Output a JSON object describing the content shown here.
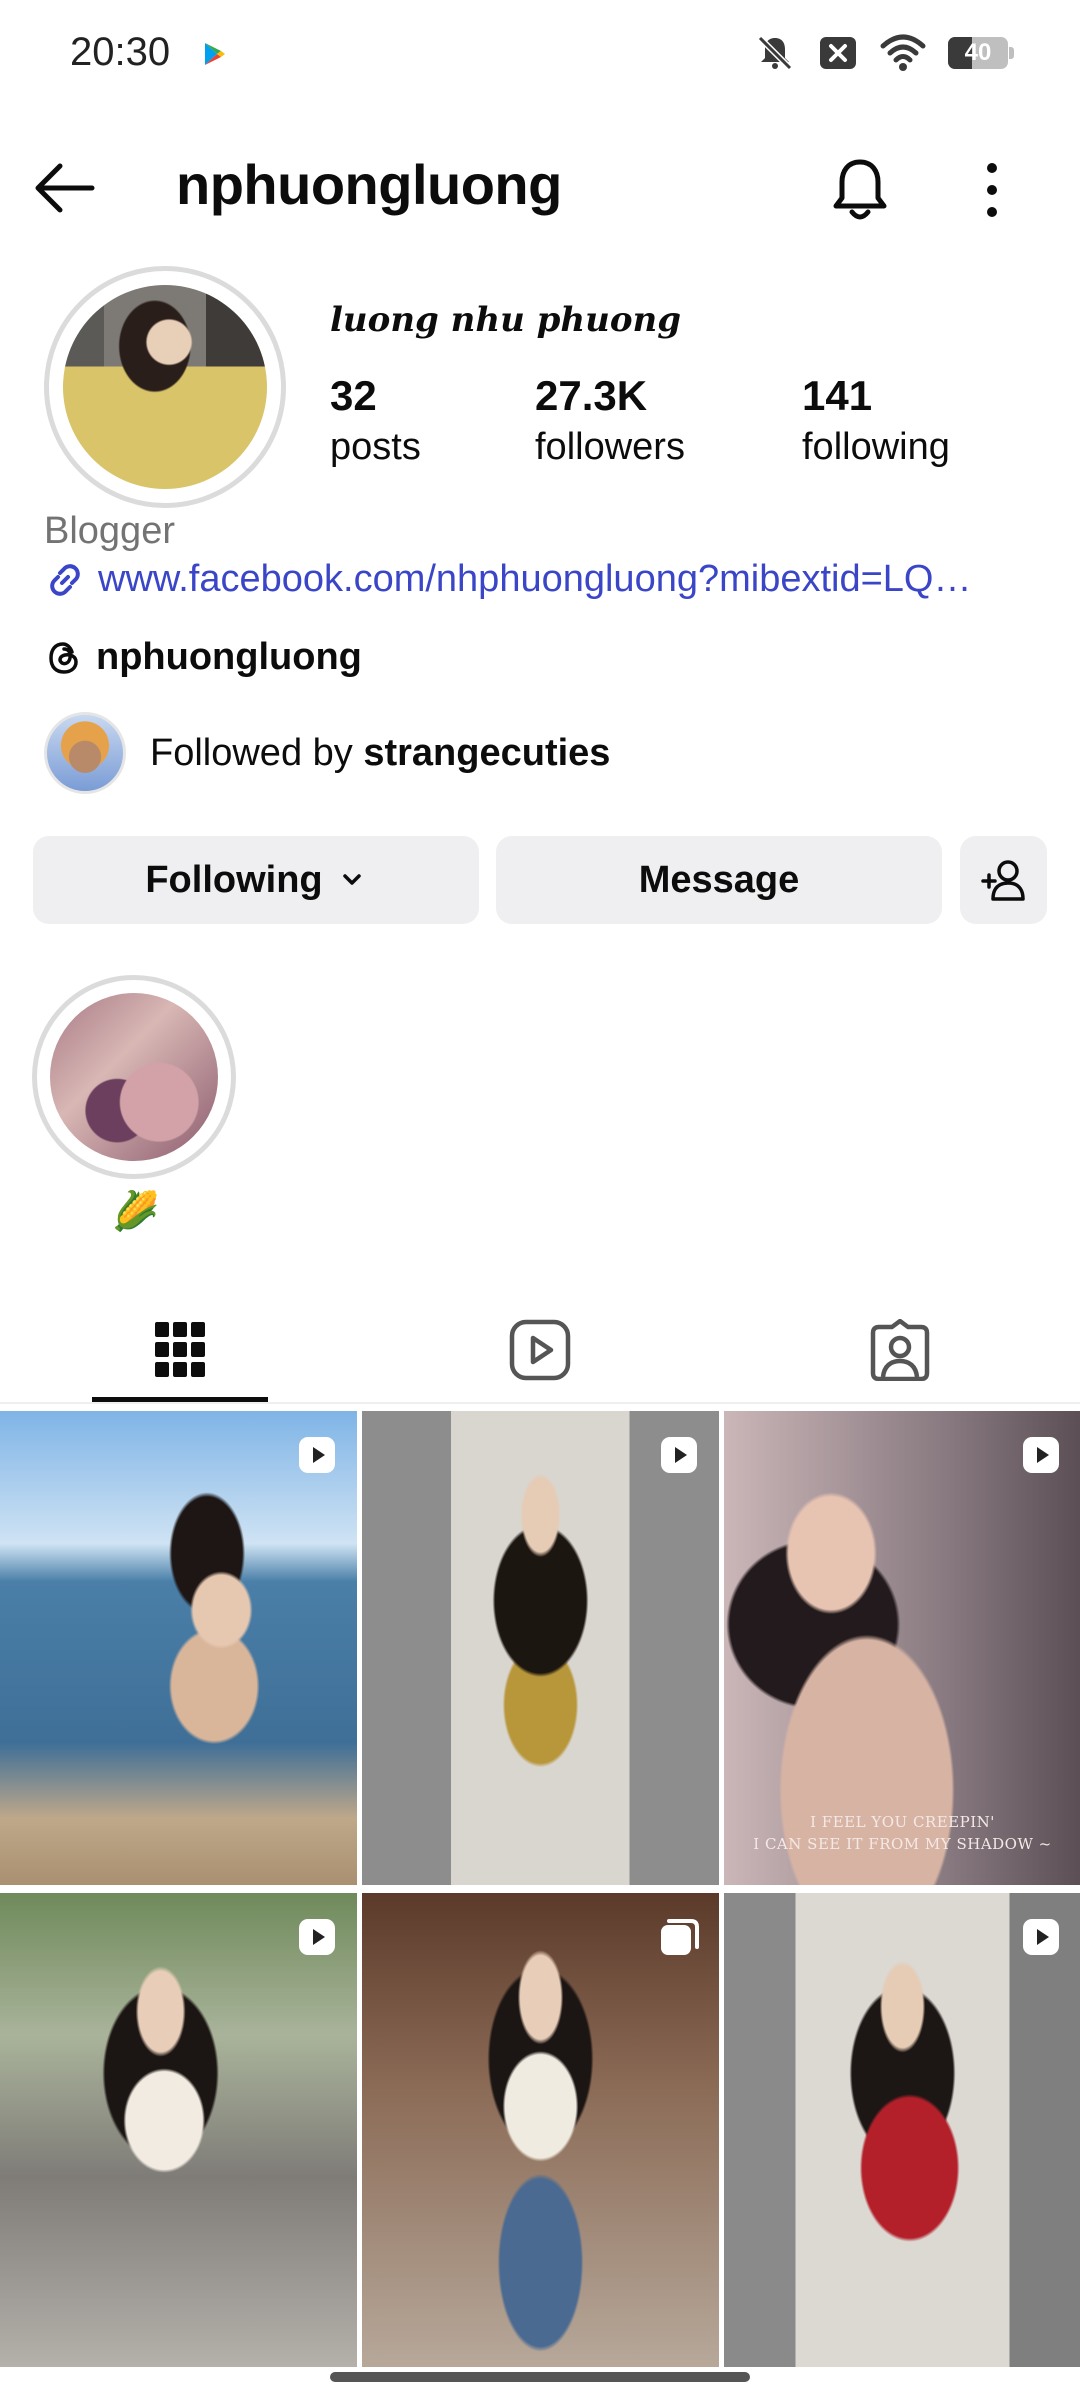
{
  "status_bar": {
    "time": "20:30",
    "battery": "40",
    "battery_level": 0.4
  },
  "header": {
    "title": "nphuongluong"
  },
  "profile": {
    "full_name": "luong nhu phuong",
    "stats": [
      {
        "value": "32",
        "label": "posts"
      },
      {
        "value": "27.3K",
        "label": "followers"
      },
      {
        "value": "141",
        "label": "following"
      }
    ],
    "category": "Blogger",
    "link": "www.facebook.com/nhphuongluong?mibextid=LQ…",
    "threads_handle": "nphuongluong",
    "followed_by_prefix": "Followed by ",
    "followed_by_user": "strangecuties"
  },
  "actions": {
    "following": "Following",
    "message": "Message"
  },
  "highlights": [
    {
      "label": "🌽"
    }
  ],
  "tabs": [
    {
      "icon": "grid-icon",
      "active": true
    },
    {
      "icon": "reels-icon",
      "active": false
    },
    {
      "icon": "tagged-icon",
      "active": false
    }
  ],
  "posts": [
    {
      "badge": "reel-icon"
    },
    {
      "badge": "reel-icon"
    },
    {
      "badge": "reel-icon",
      "caption_lines": [
        "I FEEL YOU CREEPIN'",
        "I CAN SEE IT FROM MY SHADOW ~"
      ]
    },
    {
      "badge": "reel-icon"
    },
    {
      "badge": "carousel-icon"
    },
    {
      "badge": "reel-icon"
    }
  ],
  "colors": {
    "link": "#3a46c7",
    "button_bg": "#efeff1",
    "secondary_text": "#737373"
  }
}
